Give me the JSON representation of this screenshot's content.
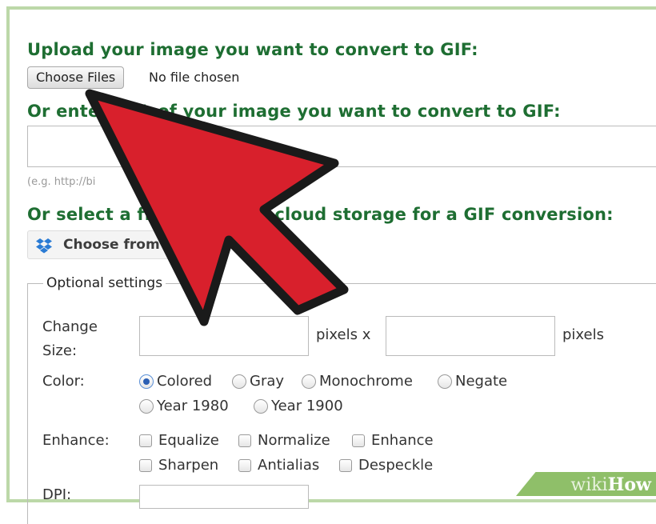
{
  "upload": {
    "heading": "Upload your image you want to convert to GIF:",
    "choose_files_label": "Choose Files",
    "file_status": "No file chosen"
  },
  "url": {
    "heading": "Or enter URL of your image you want to convert to GIF:",
    "value": "",
    "hint": "(e.g. http://bi"
  },
  "cloud": {
    "heading": "Or select a file from your cloud storage for a GIF conversion:",
    "dropbox_label": "Choose from Dropbox"
  },
  "settings": {
    "legend": "Optional settings",
    "size_label_line1": "Change",
    "size_label_line2": "Size:",
    "width_value": "",
    "height_value": "",
    "pixels_x": "pixels x",
    "pixels": "pixels",
    "color_label": "Color:",
    "color_options": [
      "Colored",
      "Gray",
      "Monochrome",
      "Negate",
      "Year 1980",
      "Year 1900"
    ],
    "color_selected": "Colored",
    "enhance_label": "Enhance:",
    "enhance_options": [
      "Equalize",
      "Normalize",
      "Enhance",
      "Sharpen",
      "Antialias",
      "Despeckle"
    ],
    "dpi_label": "DPI:"
  },
  "watermark": {
    "part1": "wiki",
    "part2": "How"
  },
  "colors": {
    "heading_green": "#1e6e32",
    "border_green": "#bcd8a8",
    "arrow_red": "#d8202c",
    "radio_blue": "#2b5fb4",
    "watermark_green": "#8fbf69"
  }
}
